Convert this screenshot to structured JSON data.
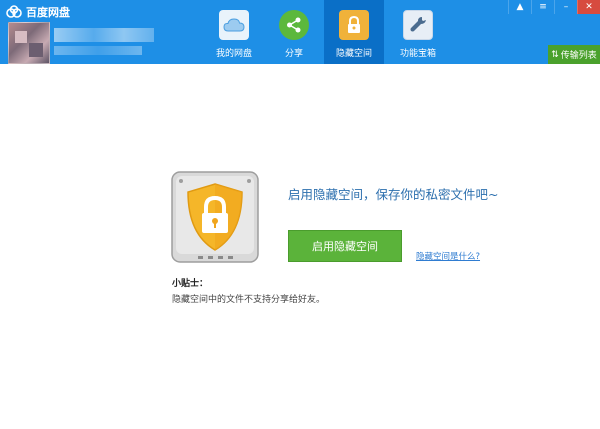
{
  "app": {
    "title": "百度网盘"
  },
  "user": {
    "avatar": "blurred-avatar",
    "name": "",
    "info": ""
  },
  "tabs": [
    {
      "label": "我的网盘",
      "icon": "cloud-icon",
      "active": false
    },
    {
      "label": "分享",
      "icon": "share-icon",
      "active": false
    },
    {
      "label": "隐藏空间",
      "icon": "lock-icon",
      "active": true
    },
    {
      "label": "功能宝箱",
      "icon": "wrench-icon",
      "active": false
    }
  ],
  "window_controls": [
    "bell-icon",
    "menu-icon",
    "minimize-icon",
    "close-icon"
  ],
  "transfer": {
    "label": "传输列表",
    "icon": "transfer-arrows-icon"
  },
  "main": {
    "headline": "启用隐藏空间，保存你的私密文件吧~",
    "enable_button": "启用隐藏空间",
    "help_link": "隐藏空间是什么?",
    "tips_title": "小贴士：",
    "tips_text": "隐藏空间中的文件不支持分享给好友。"
  },
  "colors": {
    "header": "#1e8fe6",
    "tab_active": "#0a6fc7",
    "primary_button": "#5bb33a",
    "link": "#2f7cd1",
    "headline": "#2c6fae",
    "shield": "#f5b629"
  }
}
